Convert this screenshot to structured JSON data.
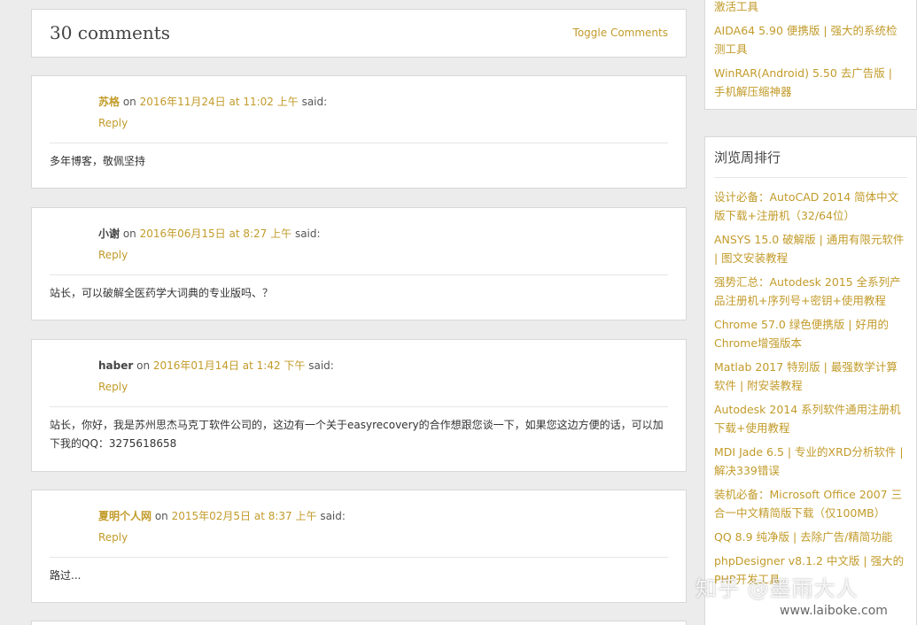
{
  "comments_header": {
    "title": "30 comments",
    "toggle_label": "Toggle Comments"
  },
  "comments": [
    {
      "author": "苏格",
      "author_linked": true,
      "on": " on ",
      "date": "2016年11月24日 at 11:02 上午",
      "said": " said:",
      "reply": "Reply",
      "body": "多年博客，敬佩坚持"
    },
    {
      "author": "小谢",
      "author_linked": false,
      "on": " on ",
      "date": "2016年06月15日 at 8:27 上午",
      "said": " said:",
      "reply": "Reply",
      "body": "站长，可以破解全医药学大词典的专业版吗、？"
    },
    {
      "author": "haber",
      "author_linked": false,
      "on": " on ",
      "date": "2016年01月14日 at 1:42 下午",
      "said": " said:",
      "reply": "Reply",
      "body": "站长，你好，我是苏州思杰马克丁软件公司的，这边有一个关于easyrecovery的合作想跟您谈一下，如果您这边方便的话，可以加下我的QQ：3275618658"
    },
    {
      "author": "夏明个人网",
      "author_linked": true,
      "on": " on ",
      "date": "2015年02月5日 at 8:37 上午",
      "said": " said:",
      "reply": "Reply",
      "body": "路过..."
    }
  ],
  "sidebar_top": {
    "links": [
      "激活工具",
      "AIDA64 5.90 便携版 | 强大的系统检测工具",
      "WinRAR(Android) 5.50 去广告版 | 手机解压缩神器"
    ]
  },
  "sidebar_weekly": {
    "title": "浏览周排行",
    "links": [
      "设计必备：AutoCAD 2014 简体中文版下载+注册机（32/64位）",
      "ANSYS 15.0 破解版 | 通用有限元软件 | 图文安装教程",
      "强势汇总：Autodesk 2015 全系列产品注册机+序列号+密钥+使用教程",
      "Chrome 57.0 绿色便携版 | 好用的Chrome增强版本",
      "Matlab 2017 特别版 | 最强数学计算软件 | 附安装教程",
      "Autodesk 2014 系列软件通用注册机下载+使用教程",
      "MDI Jade 6.5 | 专业的XRD分析软件 | 解决339错误",
      "装机必备：Microsoft Office 2007 三合一中文精简版下载（仅100MB）",
      "QQ 8.9 纯净版 | 去除广告/精简功能",
      "phpDesigner v8.1.2 中文版 | 强大的PHP开发工具"
    ]
  },
  "watermark": {
    "text": "知乎 @墨雨大人",
    "url": "www.laiboke.com"
  }
}
